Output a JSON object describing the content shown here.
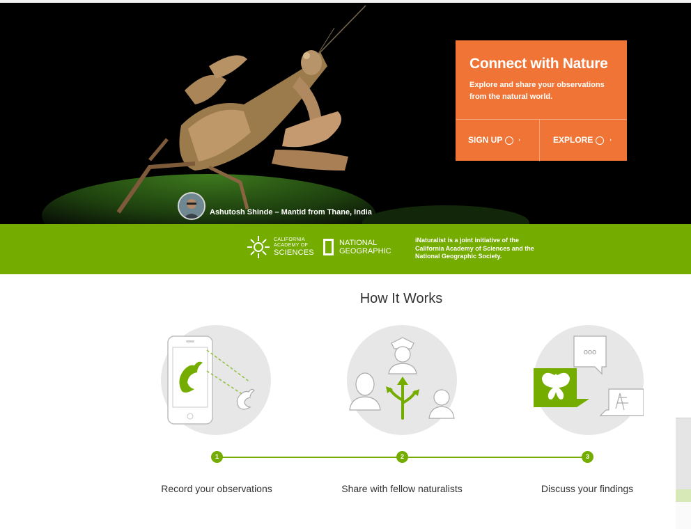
{
  "hero": {
    "cta_title": "Connect with Nature",
    "cta_subtitle": "Explore and share your observations from the natural world.",
    "signup_label": "SIGN UP",
    "explore_label": "EXPLORE",
    "photo_credit": "Ashutosh Shinde  –  Mantid from Thane, India"
  },
  "partners": {
    "cas_line1": "CALIFORNIA",
    "cas_line2": "ACADEMY OF",
    "cas_line3": "SCIENCES",
    "ng_line1": "NATIONAL",
    "ng_line2": "GEOGRAPHIC",
    "initiative_text": "iNaturalist is a joint initiative of the California Academy of Sciences and the National Geographic Society."
  },
  "how_it_works": {
    "title": "How It Works",
    "steps": [
      {
        "number": "1",
        "label": "Record your observations",
        "icon": "phone-caterpillar-icon"
      },
      {
        "number": "2",
        "label": "Share with fellow naturalists",
        "icon": "people-share-icon"
      },
      {
        "number": "3",
        "label": "Discuss your findings",
        "icon": "chat-butterfly-icon"
      }
    ]
  },
  "colors": {
    "accent_orange": "#f07435",
    "brand_green": "#74ac00"
  }
}
